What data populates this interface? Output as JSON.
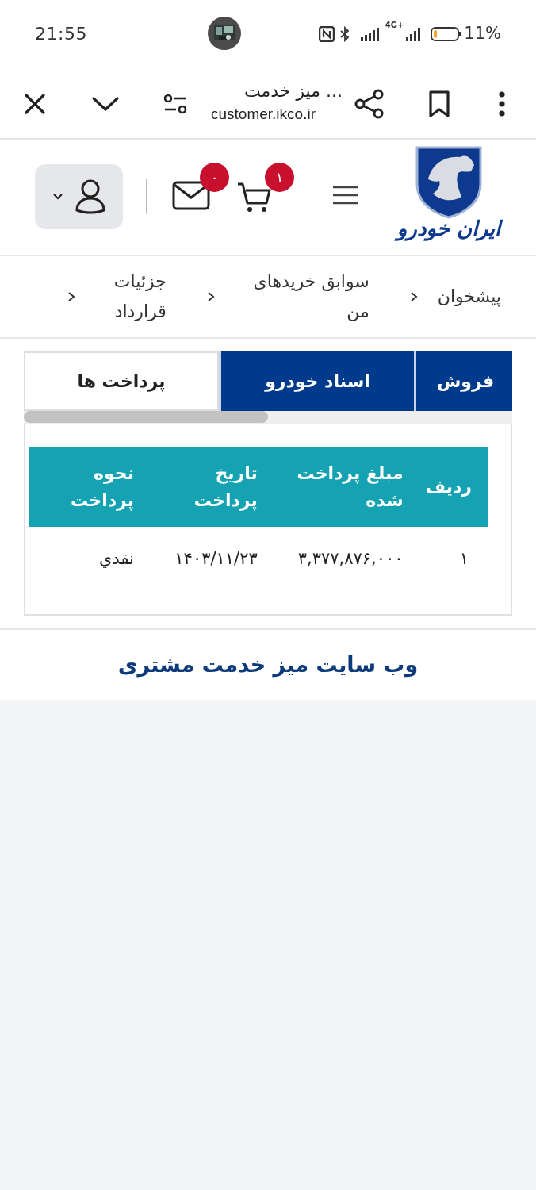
{
  "status_bar": {
    "time": "21:55",
    "network": "4G+",
    "battery": "11%"
  },
  "browser": {
    "page_title": "میز خدمت ...",
    "url": "customer.ikco.ir"
  },
  "header": {
    "logo_text": "ایران خودرو",
    "cart_count": "۱",
    "messages_count": "۰"
  },
  "breadcrumbs": [
    "پیشخوان",
    "سوابق خریدهای من",
    "جزئیات قرارداد"
  ],
  "tabs": [
    {
      "label": "فروش",
      "selected": false
    },
    {
      "label": "اسناد خودرو",
      "selected": false
    },
    {
      "label": "پرداخت ها",
      "selected": true
    }
  ],
  "table": {
    "columns": [
      "ردیف",
      "مبلغ پرداخت شده",
      "تاریخ پرداخت",
      "نحوه پرداخت"
    ],
    "rows": [
      [
        "۱",
        "۳,۳۷۷,۸۷۶,۰۰۰",
        "۱۴۰۳/۱۱/۲۳",
        "نقدي"
      ]
    ]
  },
  "footer": {
    "title": "وب سایت میز خدمت مشتری"
  }
}
